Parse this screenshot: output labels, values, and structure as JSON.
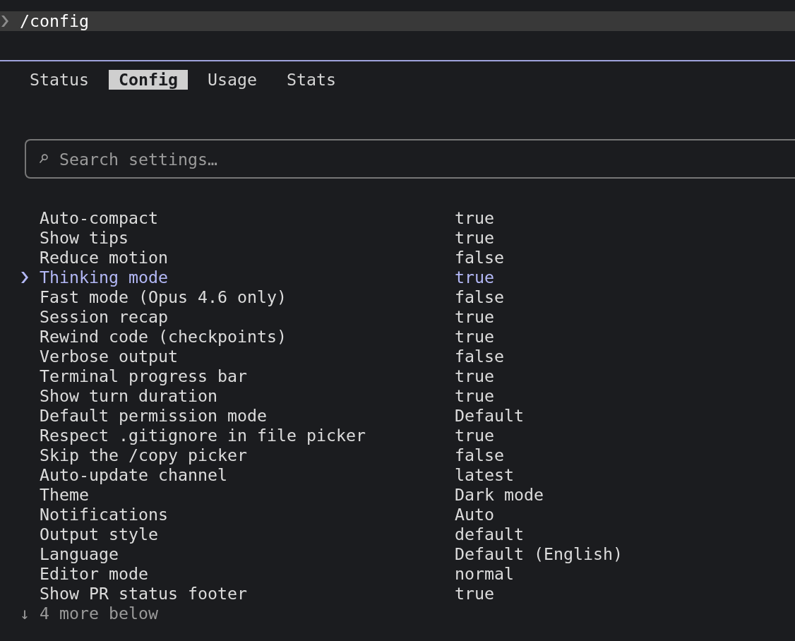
{
  "prompt": {
    "command": "/config"
  },
  "tabs": [
    {
      "label": "Status",
      "selected": false
    },
    {
      "label": "Config",
      "selected": true
    },
    {
      "label": "Usage",
      "selected": false
    },
    {
      "label": "Stats",
      "selected": false
    }
  ],
  "search": {
    "placeholder": "Search settings…"
  },
  "settings": [
    {
      "label": "Auto-compact",
      "value": "true",
      "selected": false
    },
    {
      "label": "Show tips",
      "value": "true",
      "selected": false
    },
    {
      "label": "Reduce motion",
      "value": "false",
      "selected": false
    },
    {
      "label": "Thinking mode",
      "value": "true",
      "selected": true
    },
    {
      "label": "Fast mode (Opus 4.6 only)",
      "value": "false",
      "selected": false
    },
    {
      "label": "Session recap",
      "value": "true",
      "selected": false
    },
    {
      "label": "Rewind code (checkpoints)",
      "value": "true",
      "selected": false
    },
    {
      "label": "Verbose output",
      "value": "false",
      "selected": false
    },
    {
      "label": "Terminal progress bar",
      "value": "true",
      "selected": false
    },
    {
      "label": "Show turn duration",
      "value": "true",
      "selected": false
    },
    {
      "label": "Default permission mode",
      "value": "Default",
      "selected": false
    },
    {
      "label": "Respect .gitignore in file picker",
      "value": "true",
      "selected": false
    },
    {
      "label": "Skip the /copy picker",
      "value": "false",
      "selected": false
    },
    {
      "label": "Auto-update channel",
      "value": "latest",
      "selected": false
    },
    {
      "label": "Theme",
      "value": "Dark mode",
      "selected": false
    },
    {
      "label": "Notifications",
      "value": "Auto",
      "selected": false
    },
    {
      "label": "Output style",
      "value": "default",
      "selected": false
    },
    {
      "label": "Language",
      "value": "Default (English)",
      "selected": false
    },
    {
      "label": "Editor mode",
      "value": "normal",
      "selected": false
    },
    {
      "label": "Show PR status footer",
      "value": "true",
      "selected": false
    }
  ],
  "more_below": "↓ 4 more below"
}
